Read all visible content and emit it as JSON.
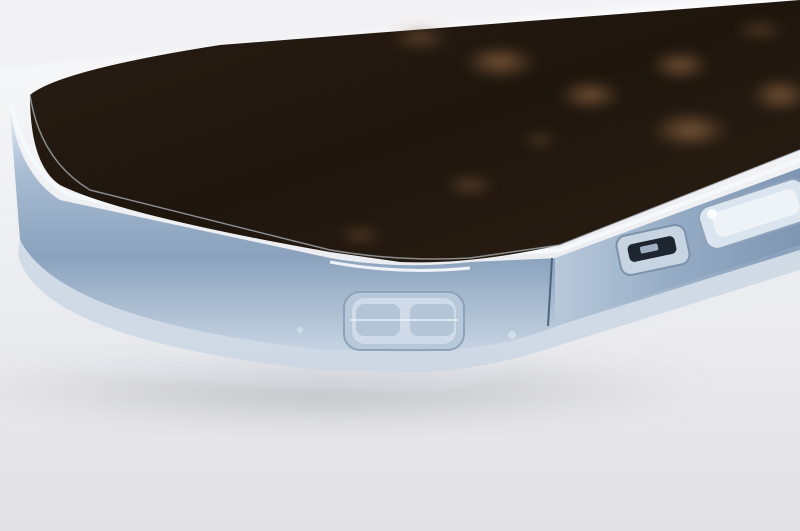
{
  "scene": {
    "subject": "smartphone-in-clear-case",
    "colors": {
      "backdrop": "#f4f4f6",
      "backdrop_shadow": "#d9dade",
      "frame": "#9fb4cc",
      "frame_light": "#d8e4f0",
      "frame_dark": "#5f7590",
      "screen": "#231910",
      "screen_glow": "#6b4a2c",
      "case_edge": "#eef3f8"
    }
  }
}
